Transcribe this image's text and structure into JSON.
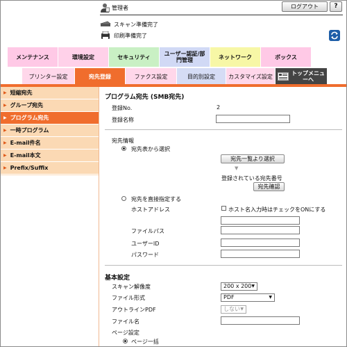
{
  "header": {
    "admin_label": "管理者",
    "logout_label": "ログアウト",
    "help_label": "?",
    "status_scan": "スキャン準備完了",
    "status_print": "印刷準備完了"
  },
  "top_tabs": [
    {
      "label": "メンテナンス",
      "color": "#ffc9e6"
    },
    {
      "label": "環境設定",
      "color": "#ffd1e9"
    },
    {
      "label": "セキュリティ",
      "color": "#c9f0c4"
    },
    {
      "label": "ユーザー認証/部門管理",
      "color": "#d1d9f5"
    },
    {
      "label": "ネットワーク",
      "color": "#f7f7a6"
    },
    {
      "label": "ボックス",
      "color": "#ffc9e6"
    }
  ],
  "sub_tabs": [
    {
      "label": "プリンター設定",
      "color": "#ffd7ea"
    },
    {
      "label": "宛先登録",
      "color": "#f06d2d"
    },
    {
      "label": "ファクス設定",
      "color": "#ffd7ea"
    },
    {
      "label": "目的別設定",
      "color": "#d5dcf5"
    },
    {
      "label": "カスタマイズ設定",
      "color": "#ffd7ea"
    },
    {
      "label": "トップメニューへ",
      "color": "#444444"
    }
  ],
  "sidebar": {
    "items": [
      {
        "label": "短縮宛先"
      },
      {
        "label": "グループ宛先"
      },
      {
        "label": "プログラム宛先"
      },
      {
        "label": "一時プログラム"
      },
      {
        "label": "E-mail件名"
      },
      {
        "label": "E-mail本文"
      },
      {
        "label": "Prefix/Suffix"
      }
    ]
  },
  "form": {
    "title": "プログラム宛先 (SMB宛先)",
    "reg_no_label": "登録No.",
    "reg_no_value": "2",
    "reg_name_label": "登録名称",
    "dest_info_label": "宛先情報",
    "radio_from_list": "宛先表から選択",
    "btn_select_from_list": "宛先一覧より選択",
    "registered_label": "登録されている宛先番号",
    "btn_confirm": "宛先確認",
    "radio_direct": "宛先を直接指定する",
    "host_address_label": "ホストアドレス",
    "host_checkbox_label": "ホスト名入力時はチェックをONにする",
    "file_path_label": "ファイルパス",
    "user_id_label": "ユーザーID",
    "password_label": "パスワード",
    "basic_settings_title": "基本設定",
    "resolution_label": "スキャン解像度",
    "resolution_value": "200 x 200",
    "file_format_label": "ファイル形式",
    "file_format_value": "PDF",
    "outline_label": "アウトラインPDF",
    "outline_value": "しない",
    "file_name_label": "ファイル名",
    "page_setting_label": "ページ設定",
    "page_all_label": "ページ一括"
  }
}
